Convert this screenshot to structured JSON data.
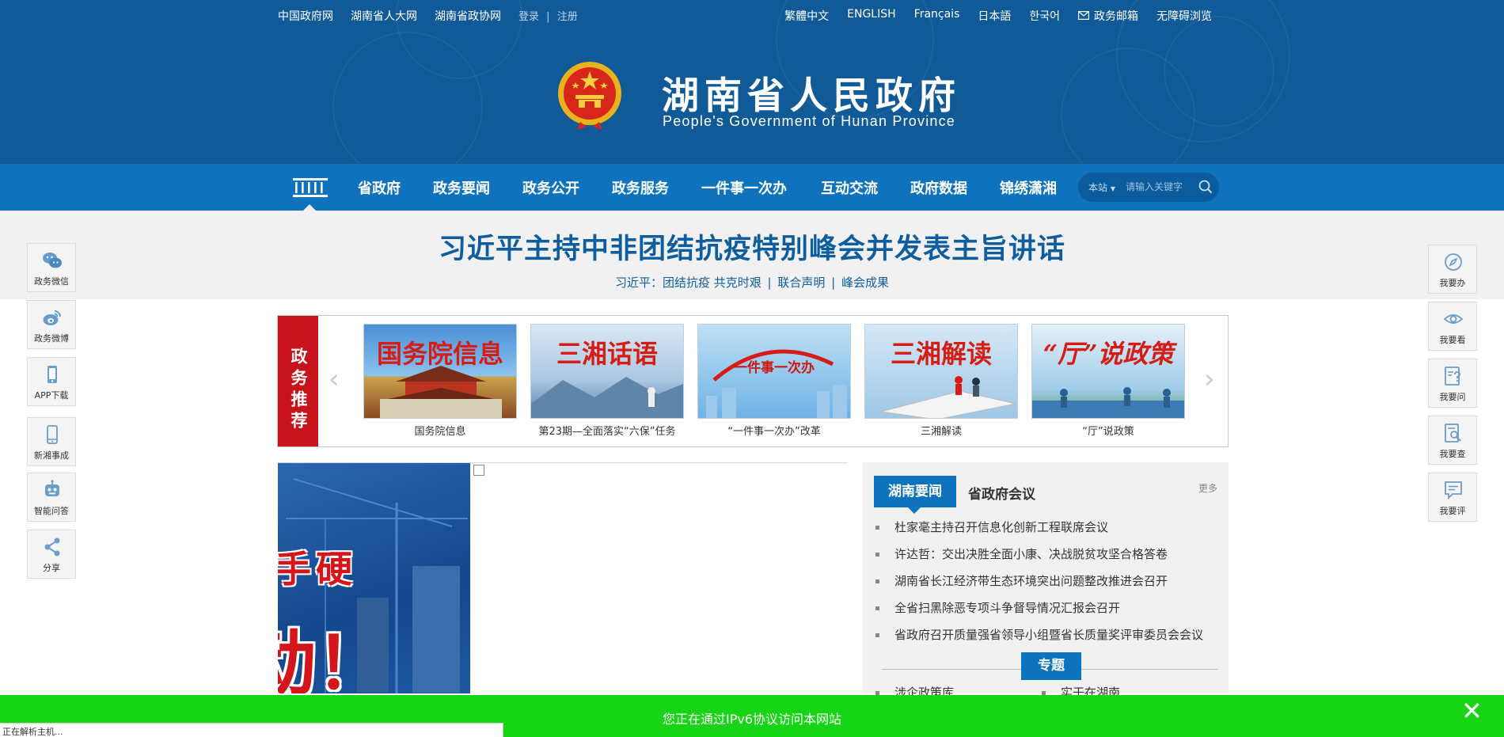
{
  "topbar": {
    "left_links": [
      "中国政府网",
      "湖南省人大网",
      "湖南省政协网"
    ],
    "login": "登录",
    "separator": "|",
    "register": "注册",
    "right_links": [
      "繁體中文",
      "ENGLISH",
      "Français",
      "日本語",
      "한국어"
    ],
    "mail": "政务邮箱",
    "accessibility": "无障碍浏览"
  },
  "header": {
    "title": "湖南省人民政府",
    "subtitle": "People's Government of Hunan Province"
  },
  "nav": {
    "items": [
      "省政府",
      "政务要闻",
      "政务公开",
      "政务服务",
      "一件事一次办",
      "互动交流",
      "政府数据",
      "锦绣潇湘"
    ],
    "search_scope": "本站",
    "search_placeholder": "请输入关键字"
  },
  "banner": {
    "headline": "习近平主持中非团结抗疫特别峰会并发表主旨讲话",
    "prefix": "习近平：",
    "links": [
      "团结抗疫 共克时艰",
      "联合声明",
      "峰会成果"
    ],
    "separator": "|"
  },
  "left_dock": [
    {
      "label": "政务微信",
      "icon": "wechat-icon"
    },
    {
      "label": "政务微博",
      "icon": "weibo-icon"
    },
    {
      "label": "APP下载",
      "icon": "phone-icon"
    },
    {
      "label": "新湘事成",
      "icon": "phone-icon"
    },
    {
      "label": "智能问答",
      "icon": "robot-icon"
    },
    {
      "label": "分享",
      "icon": "share-icon"
    }
  ],
  "right_dock": [
    {
      "label": "我要办",
      "icon": "compass-icon"
    },
    {
      "label": "我要看",
      "icon": "eye-icon"
    },
    {
      "label": "我要问",
      "icon": "question-icon"
    },
    {
      "label": "我要查",
      "icon": "search-doc-icon"
    },
    {
      "label": "我要评",
      "icon": "comment-icon"
    }
  ],
  "recommend": {
    "tag": "政务推荐",
    "items": [
      {
        "image_text": "国务院信息",
        "caption": "国务院信息"
      },
      {
        "image_text": "三湘话语",
        "caption": "第23期—全面落实“六保”任务"
      },
      {
        "image_text": "一件事一次办",
        "caption": "“一件事一次办”改革"
      },
      {
        "image_text": "三湘解读",
        "caption": "三湘解读"
      },
      {
        "image_text": "“厅”说政策",
        "caption": "“厅”说政策"
      }
    ]
  },
  "carousel": {
    "line1": "手硬",
    "line2": "动！"
  },
  "news": {
    "tab_active": "湖南要闻",
    "tab_other": "省政府会议",
    "more": "更多",
    "items": [
      "杜家毫主持召开信息化创新工程联席会议",
      "许达哲：交出决胜全面小康、决战脱贫攻坚合格答卷",
      "湖南省长江经济带生态环境突出问题整改推进会召开",
      "全省扫黑除恶专项斗争督导情况汇报会召开",
      "省政府召开质量强省领导小组暨省长质量奖评审委员会会议"
    ],
    "special": "专题",
    "special_items": [
      "涉企政策库",
      "实干在湖南"
    ]
  },
  "ipv6": {
    "message": "您正在通过IPv6协议访问本网站",
    "close": "✕"
  },
  "status_bar": "正在解析主机..."
}
